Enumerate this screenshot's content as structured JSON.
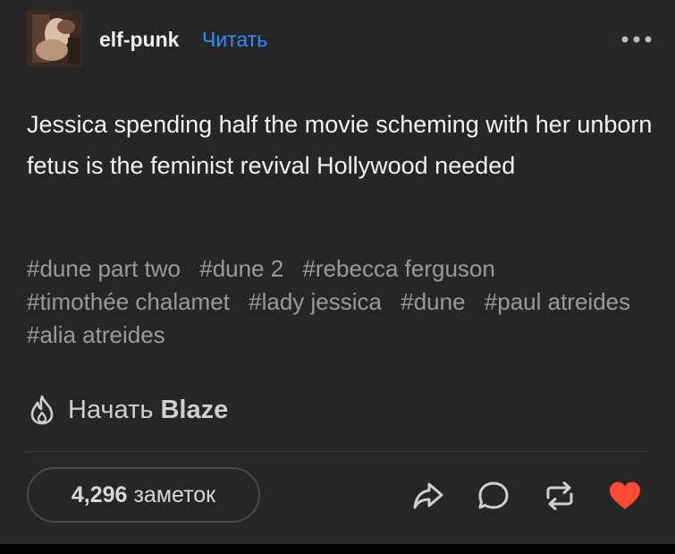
{
  "post": {
    "blog_name": "elf-punk",
    "follow_label": "Читать",
    "body_text": "Jessica spending half the movie scheming with her unborn fetus is the feminist revival Hollywood needed",
    "tags": [
      "#dune part two",
      "#dune 2",
      "#rebecca ferguson",
      "#timothée chalamet",
      "#lady jessica",
      "#dune",
      "#paul atreides",
      "#alia atreides"
    ]
  },
  "blaze": {
    "prefix": "Начать",
    "brand": "Blaze",
    "icon": "flame-icon"
  },
  "footer": {
    "notes_count": "4,296",
    "notes_label": "заметок",
    "actions": [
      "share-icon",
      "reply-icon",
      "reblog-icon",
      "like-icon"
    ]
  },
  "colors": {
    "background": "#262626",
    "follow_link": "#2f8cff",
    "tag_text": "#9a9a9a",
    "like": "#ff4930"
  }
}
